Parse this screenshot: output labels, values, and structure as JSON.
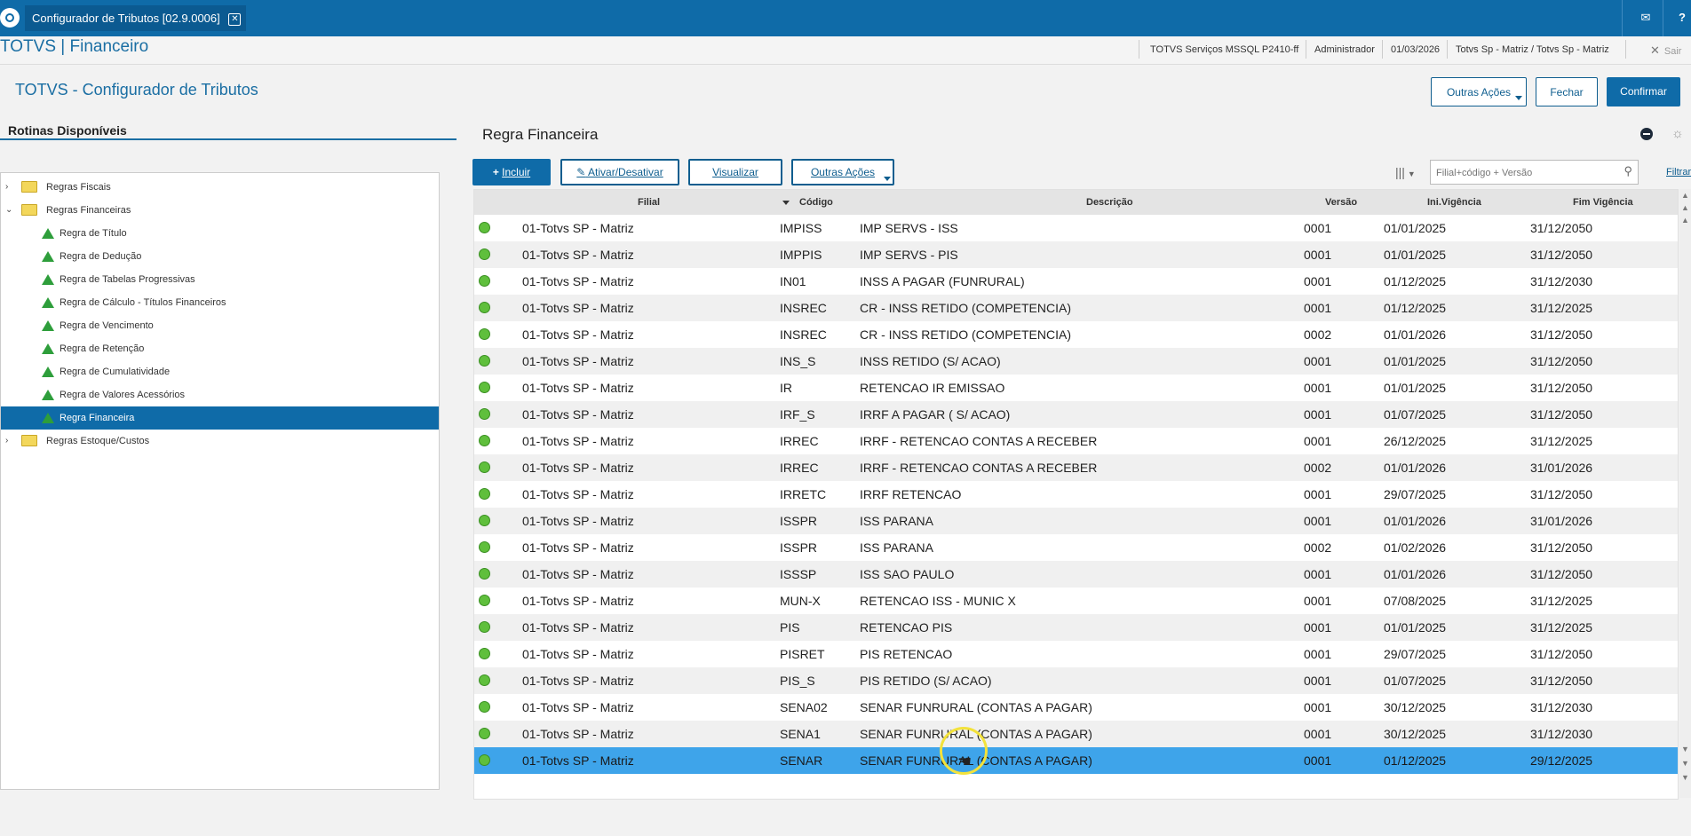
{
  "titlebar": {
    "tab_title": "Configurador de Tributos [02.9.0006]",
    "mail_icon": "mail-icon",
    "help_icon": "help-icon"
  },
  "header": {
    "brand": "TOTVS | Financeiro",
    "environment": "TOTVS Serviços MSSQL P2410-ff",
    "user": "Administrador",
    "date": "01/03/2026",
    "branch": "Totvs Sp - Matriz / Totvs Sp - Matriz",
    "exit": "Sair"
  },
  "page": {
    "title": "TOTVS - Configurador de Tributos",
    "actions": {
      "other": "Outras Ações",
      "close": "Fechar",
      "confirm": "Confirmar"
    }
  },
  "left_panel": {
    "title": "Rotinas Disponíveis",
    "tree": [
      {
        "label": "Regras Fiscais",
        "type": "folder",
        "level": 0,
        "expanded": false
      },
      {
        "label": "Regras Financeiras",
        "type": "folder",
        "level": 0,
        "expanded": true
      },
      {
        "label": "Regra de Título",
        "type": "item",
        "level": 1
      },
      {
        "label": "Regra de Dedução",
        "type": "item",
        "level": 1
      },
      {
        "label": "Regra de Tabelas Progressivas",
        "type": "item",
        "level": 1
      },
      {
        "label": "Regra de Cálculo - Títulos Financeiros",
        "type": "item",
        "level": 1
      },
      {
        "label": "Regra de Vencimento",
        "type": "item",
        "level": 1
      },
      {
        "label": "Regra de Retenção",
        "type": "item",
        "level": 1
      },
      {
        "label": "Regra de Cumulatividade",
        "type": "item",
        "level": 1
      },
      {
        "label": "Regra de Valores Acessórios",
        "type": "item",
        "level": 1
      },
      {
        "label": "Regra Financeira",
        "type": "item",
        "level": 1,
        "selected": true
      },
      {
        "label": "Regras Estoque/Custos",
        "type": "folder",
        "level": 0,
        "expanded": false
      }
    ]
  },
  "right_panel": {
    "title": "Regra Financeira",
    "toolbar": {
      "include": "Incluir",
      "toggle": "Ativar/Desativar",
      "view": "Visualizar",
      "other": "Outras Ações",
      "search_placeholder": "Filial+código + Versão",
      "filter": "Filtrar"
    },
    "columns": {
      "filial": "Filial",
      "codigo": "Código",
      "descricao": "Descrição",
      "versao": "Versão",
      "ini": "Ini.Vigência",
      "fim": "Fim Vigência"
    },
    "rows": [
      {
        "filial": "01-Totvs SP - Matriz",
        "codigo": "IMPISS",
        "descricao": "IMP SERVS - ISS",
        "versao": "0001",
        "ini": "01/01/2025",
        "fim": "31/12/2050"
      },
      {
        "filial": "01-Totvs SP - Matriz",
        "codigo": "IMPPIS",
        "descricao": "IMP SERVS - PIS",
        "versao": "0001",
        "ini": "01/01/2025",
        "fim": "31/12/2050"
      },
      {
        "filial": "01-Totvs SP - Matriz",
        "codigo": "IN01",
        "descricao": "INSS A PAGAR (FUNRURAL)",
        "versao": "0001",
        "ini": "01/12/2025",
        "fim": "31/12/2030"
      },
      {
        "filial": "01-Totvs SP - Matriz",
        "codigo": "INSREC",
        "descricao": "CR - INSS RETIDO (COMPETENCIA)",
        "versao": "0001",
        "ini": "01/12/2025",
        "fim": "31/12/2025"
      },
      {
        "filial": "01-Totvs SP - Matriz",
        "codigo": "INSREC",
        "descricao": "CR - INSS RETIDO (COMPETENCIA)",
        "versao": "0002",
        "ini": "01/01/2026",
        "fim": "31/12/2050"
      },
      {
        "filial": "01-Totvs SP - Matriz",
        "codigo": "INS_S",
        "descricao": "INSS RETIDO (S/ ACAO)",
        "versao": "0001",
        "ini": "01/01/2025",
        "fim": "31/12/2050"
      },
      {
        "filial": "01-Totvs SP - Matriz",
        "codigo": "IR",
        "descricao": "RETENCAO IR EMISSAO",
        "versao": "0001",
        "ini": "01/01/2025",
        "fim": "31/12/2050"
      },
      {
        "filial": "01-Totvs SP - Matriz",
        "codigo": "IRF_S",
        "descricao": "IRRF A PAGAR ( S/ ACAO)",
        "versao": "0001",
        "ini": "01/07/2025",
        "fim": "31/12/2050"
      },
      {
        "filial": "01-Totvs SP - Matriz",
        "codigo": "IRREC",
        "descricao": "IRRF - RETENCAO CONTAS A RECEBER",
        "versao": "0001",
        "ini": "26/12/2025",
        "fim": "31/12/2025"
      },
      {
        "filial": "01-Totvs SP - Matriz",
        "codigo": "IRREC",
        "descricao": "IRRF - RETENCAO CONTAS A RECEBER",
        "versao": "0002",
        "ini": "01/01/2026",
        "fim": "31/01/2026"
      },
      {
        "filial": "01-Totvs SP - Matriz",
        "codigo": "IRRETC",
        "descricao": "IRRF RETENCAO",
        "versao": "0001",
        "ini": "29/07/2025",
        "fim": "31/12/2050"
      },
      {
        "filial": "01-Totvs SP - Matriz",
        "codigo": "ISSPR",
        "descricao": "ISS PARANA",
        "versao": "0001",
        "ini": "01/01/2026",
        "fim": "31/01/2026"
      },
      {
        "filial": "01-Totvs SP - Matriz",
        "codigo": "ISSPR",
        "descricao": "ISS PARANA",
        "versao": "0002",
        "ini": "01/02/2026",
        "fim": "31/12/2050"
      },
      {
        "filial": "01-Totvs SP - Matriz",
        "codigo": "ISSSP",
        "descricao": "ISS SAO PAULO",
        "versao": "0001",
        "ini": "01/01/2026",
        "fim": "31/12/2050"
      },
      {
        "filial": "01-Totvs SP - Matriz",
        "codigo": "MUN-X",
        "descricao": "RETENCAO ISS - MUNIC X",
        "versao": "0001",
        "ini": "07/08/2025",
        "fim": "31/12/2025"
      },
      {
        "filial": "01-Totvs SP - Matriz",
        "codigo": "PIS",
        "descricao": "RETENCAO PIS",
        "versao": "0001",
        "ini": "01/01/2025",
        "fim": "31/12/2025"
      },
      {
        "filial": "01-Totvs SP - Matriz",
        "codigo": "PISRET",
        "descricao": "PIS RETENCAO",
        "versao": "0001",
        "ini": "29/07/2025",
        "fim": "31/12/2050"
      },
      {
        "filial": "01-Totvs SP - Matriz",
        "codigo": "PIS_S",
        "descricao": "PIS RETIDO (S/ ACAO)",
        "versao": "0001",
        "ini": "01/07/2025",
        "fim": "31/12/2050"
      },
      {
        "filial": "01-Totvs SP - Matriz",
        "codigo": "SENA02",
        "descricao": "SENAR FUNRURAL (CONTAS A PAGAR)",
        "versao": "0001",
        "ini": "30/12/2025",
        "fim": "31/12/2030"
      },
      {
        "filial": "01-Totvs SP - Matriz",
        "codigo": "SENA1",
        "descricao": "SENAR FUNRURAL (CONTAS A PAGAR)",
        "versao": "0001",
        "ini": "30/12/2025",
        "fim": "31/12/2030"
      },
      {
        "filial": "01-Totvs SP - Matriz",
        "codigo": "SENAR",
        "descricao": "SENAR FUNRURAL (CONTAS A PAGAR)",
        "versao": "0001",
        "ini": "01/12/2025",
        "fim": "29/12/2025",
        "selected": true
      }
    ]
  },
  "colors": {
    "primary": "#0f6ba8",
    "selected_row": "#3ea4ea",
    "status_active": "#5fbf3c"
  }
}
